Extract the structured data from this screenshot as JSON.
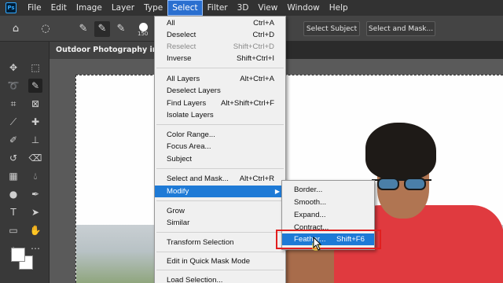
{
  "app": {
    "logo_text": "Ps"
  },
  "menubar": {
    "items": [
      "File",
      "Edit",
      "Image",
      "Layer",
      "Type",
      "Select",
      "Filter",
      "3D",
      "View",
      "Window",
      "Help"
    ]
  },
  "options_bar": {
    "brush_size": "150",
    "select_subject_label": "Select Subject",
    "select_and_mask_label": "Select and Mask..."
  },
  "document": {
    "tab_title": "Outdoor Photography image"
  },
  "select_menu": {
    "items": [
      {
        "label": "All",
        "shortcut": "Ctrl+A",
        "disabled": false
      },
      {
        "label": "Deselect",
        "shortcut": "Ctrl+D",
        "disabled": false
      },
      {
        "label": "Reselect",
        "shortcut": "Shift+Ctrl+D",
        "disabled": true
      },
      {
        "label": "Inverse",
        "shortcut": "Shift+Ctrl+I",
        "disabled": false
      },
      {
        "label": "All Layers",
        "shortcut": "Alt+Ctrl+A",
        "disabled": false
      },
      {
        "label": "Deselect Layers",
        "shortcut": "",
        "disabled": false
      },
      {
        "label": "Find Layers",
        "shortcut": "Alt+Shift+Ctrl+F",
        "disabled": false
      },
      {
        "label": "Isolate Layers",
        "shortcut": "",
        "disabled": false
      },
      {
        "label": "Color Range...",
        "shortcut": "",
        "disabled": false
      },
      {
        "label": "Focus Area...",
        "shortcut": "",
        "disabled": false
      },
      {
        "label": "Subject",
        "shortcut": "",
        "disabled": false
      },
      {
        "label": "Select and Mask...",
        "shortcut": "Alt+Ctrl+R",
        "disabled": false
      },
      {
        "label": "Modify",
        "shortcut": "",
        "disabled": false
      },
      {
        "label": "Grow",
        "shortcut": "",
        "disabled": false
      },
      {
        "label": "Similar",
        "shortcut": "",
        "disabled": false
      },
      {
        "label": "Transform Selection",
        "shortcut": "",
        "disabled": false
      },
      {
        "label": "Edit in Quick Mask Mode",
        "shortcut": "",
        "disabled": false
      },
      {
        "label": "Load Selection...",
        "shortcut": "",
        "disabled": false
      }
    ]
  },
  "modify_submenu": {
    "items": [
      {
        "label": "Border...",
        "shortcut": ""
      },
      {
        "label": "Smooth...",
        "shortcut": ""
      },
      {
        "label": "Expand...",
        "shortcut": ""
      },
      {
        "label": "Contract...",
        "shortcut": ""
      },
      {
        "label": "Feather...",
        "shortcut": "Shift+F6"
      }
    ]
  },
  "colors": {
    "menu_highlight": "#1e7ad6",
    "annotation_red": "#e11f1f",
    "menubar_bg": "#323232",
    "app_bg": "#535353"
  }
}
